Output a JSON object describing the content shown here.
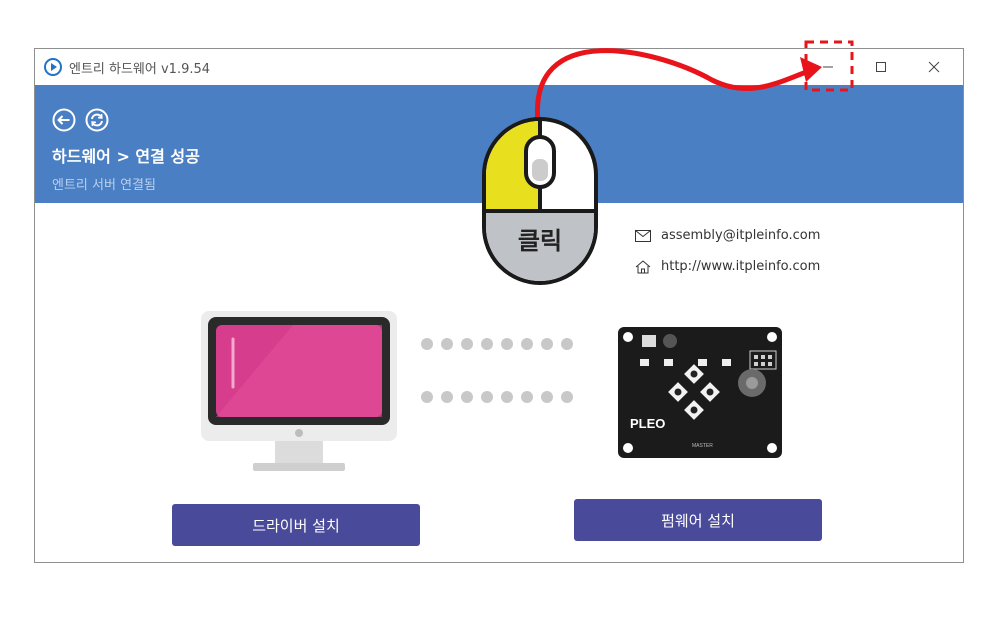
{
  "window": {
    "title": "엔트리 하드웨어 v1.9.54",
    "icon": "entry-logo-icon",
    "controls": [
      "minimize-icon",
      "maximize-icon",
      "close-icon"
    ]
  },
  "header": {
    "title": "하드웨어 > 연결 성공",
    "subtitle": "엔트리 서버 연결됨",
    "background": "#4a7fc4",
    "icons": [
      "back-arrow-icon",
      "refresh-icon"
    ]
  },
  "contact": {
    "email": "assembly@itpleinfo.com",
    "website": "http://www.itpleinfo.com",
    "email_icon": "mail-icon",
    "website_icon": "home-icon"
  },
  "illustration": {
    "computer_icon": "monitor-icon",
    "board_icon": "hardware-board-icon",
    "board_brand": "PLEO",
    "board_model": "MASTER",
    "dots_per_row": 8
  },
  "buttons": {
    "driver_install": "드라이버 설치",
    "firmware_install": "펌웨어 설치",
    "color": "#4a4a9a"
  },
  "annotation": {
    "mouse_label": "클릭",
    "mouse_icon": "mouse-left-click-icon",
    "arrow_color": "#e8141a",
    "highlight_target": "minimize-icon"
  }
}
